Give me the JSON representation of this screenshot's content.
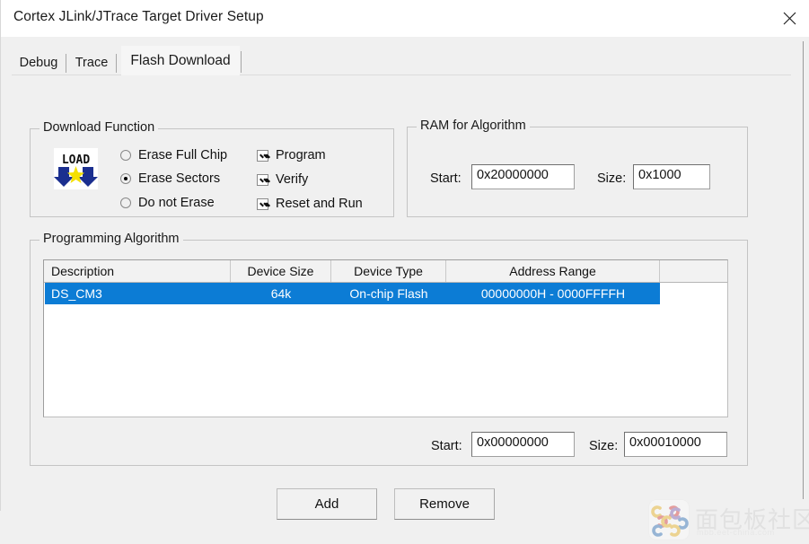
{
  "window": {
    "title": "Cortex JLink/JTrace Target Driver Setup",
    "close_icon": "close-icon"
  },
  "tabs": [
    {
      "label": "Debug",
      "active": false
    },
    {
      "label": "Trace",
      "active": false
    },
    {
      "label": "Flash Download",
      "active": true
    }
  ],
  "download_function": {
    "title": "Download Function",
    "icon": "load-icon",
    "icon_text": "LOAD",
    "radios": [
      {
        "label": "Erase Full Chip",
        "checked": false
      },
      {
        "label": "Erase Sectors",
        "checked": true
      },
      {
        "label": "Do not Erase",
        "checked": false
      }
    ],
    "checkboxes": [
      {
        "label": "Program",
        "checked": true
      },
      {
        "label": "Verify",
        "checked": true
      },
      {
        "label": "Reset and Run",
        "checked": true
      }
    ]
  },
  "ram_for_algorithm": {
    "title": "RAM for Algorithm",
    "start_label": "Start:",
    "start_value": "0x20000000",
    "size_label": "Size:",
    "size_value": "0x1000"
  },
  "programming_algorithm": {
    "title": "Programming Algorithm",
    "columns": [
      "Description",
      "Device Size",
      "Device Type",
      "Address Range",
      ""
    ],
    "rows": [
      {
        "description": "DS_CM3",
        "device_size": "64k",
        "device_type": "On-chip Flash",
        "address_range": "00000000H - 0000FFFFH",
        "selected": true
      }
    ],
    "start_label": "Start:",
    "start_value": "0x00000000",
    "size_label": "Size:",
    "size_value": "0x00010000"
  },
  "buttons": {
    "add": "Add",
    "remove": "Remove"
  },
  "watermark": {
    "text": "面包板社区",
    "url": "mbb.eet-china.com"
  },
  "colors": {
    "selection_blue": "#0c7cd5",
    "window_bg": "#f0f0f0",
    "titlebar_bg": "#ffffff",
    "field_bg": "#ffffff"
  }
}
